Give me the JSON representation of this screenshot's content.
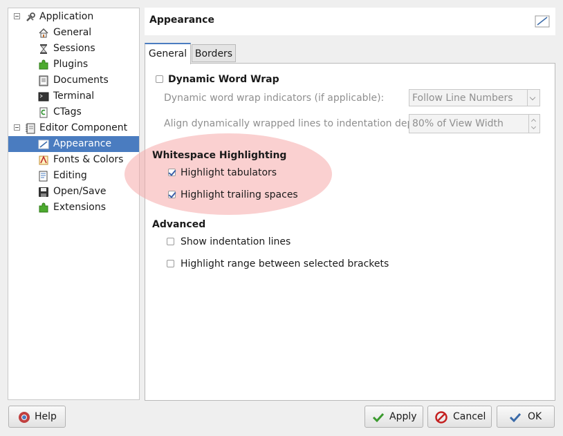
{
  "sidebar": {
    "items": [
      {
        "label": "Application",
        "icon": "wrench-icon",
        "level": 0,
        "expander": true
      },
      {
        "label": "General",
        "icon": "home-icon",
        "level": 1
      },
      {
        "label": "Sessions",
        "icon": "hourglass-icon",
        "level": 1
      },
      {
        "label": "Plugins",
        "icon": "puzzle-icon",
        "level": 1
      },
      {
        "label": "Documents",
        "icon": "documents-icon",
        "level": 1
      },
      {
        "label": "Terminal",
        "icon": "terminal-icon",
        "level": 1
      },
      {
        "label": "CTags",
        "icon": "ctags-icon",
        "level": 1
      },
      {
        "label": "Editor Component",
        "icon": "notebook-icon",
        "level": 0,
        "expander": true
      },
      {
        "label": "Appearance",
        "icon": "appearance-icon",
        "level": 1,
        "selected": true
      },
      {
        "label": "Fonts & Colors",
        "icon": "fonts-colors-icon",
        "level": 1
      },
      {
        "label": "Editing",
        "icon": "editing-icon",
        "level": 1
      },
      {
        "label": "Open/Save",
        "icon": "save-icon",
        "level": 1
      },
      {
        "label": "Extensions",
        "icon": "puzzle-icon",
        "level": 1
      }
    ]
  },
  "header": {
    "title": "Appearance"
  },
  "tabs": [
    {
      "label": "General",
      "active": true
    },
    {
      "label": "Borders",
      "active": false
    }
  ],
  "general": {
    "dynamic_word_wrap": {
      "label": "Dynamic Word Wrap",
      "checked": false
    },
    "wrap_indicators": {
      "label": "Dynamic word wrap indicators (if applicable):",
      "value": "Follow Line Numbers"
    },
    "align_wrapped": {
      "label": "Align dynamically wrapped lines to indentation depth:",
      "value": "80% of View Width"
    },
    "whitespace": {
      "heading": "Whitespace Highlighting",
      "tabulators": {
        "label": "Highlight tabulators",
        "checked": true
      },
      "trailing": {
        "label": "Highlight trailing spaces",
        "checked": true
      }
    },
    "advanced": {
      "heading": "Advanced",
      "indentation": {
        "label": "Show indentation lines",
        "checked": false
      },
      "brackets": {
        "label": "Highlight range between selected brackets",
        "checked": false
      }
    }
  },
  "buttons": {
    "help": "Help",
    "apply": "Apply",
    "cancel": "Cancel",
    "ok": "OK"
  },
  "colors": {
    "selection": "#4a7cc0",
    "highlight": "#f6aaaa"
  }
}
